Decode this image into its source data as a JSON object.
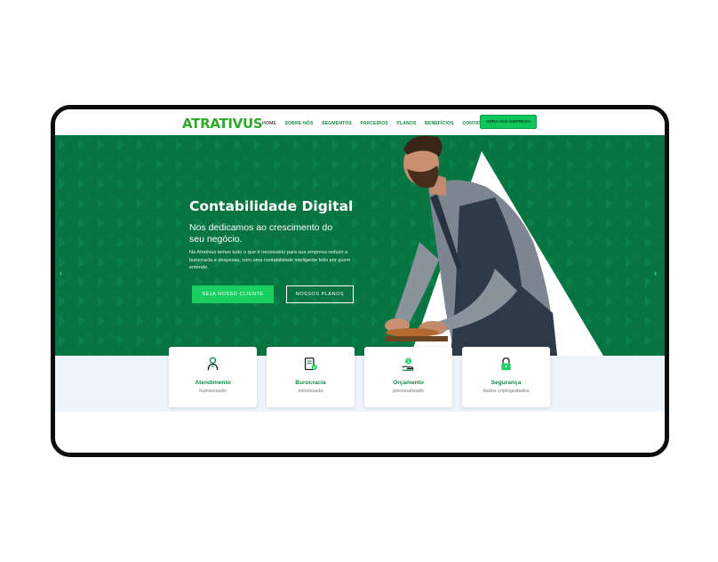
{
  "brand": {
    "name": "ATRATIVUS",
    "color": "#2fa82c"
  },
  "nav": {
    "items": [
      "HOME",
      "SOBRE NÓS",
      "SEGMENTOS",
      "PARCEIROS",
      "PLANOS",
      "BENEFÍCIOS",
      "CONTATO"
    ],
    "cta": "ABRA SUA EMPRESA"
  },
  "hero": {
    "title": "Contabilidade Digital",
    "subtitle": "Nos dedicamos ao crescimento do seu negócio.",
    "text": "Na Atrativus temos tudo o que é necessário para sua empresa reduzir a burocracia e despesas, com uma contabilidade inteligente feito por quem entende.",
    "primary_button": "SEJA NOSSO CLIENTE",
    "secondary_button": "NOSSOS PLANOS",
    "prev_arrow": "‹",
    "next_arrow": "›"
  },
  "features": [
    {
      "title": "Atendimento",
      "subtitle": "humanizado",
      "icon": "person-icon"
    },
    {
      "title": "Burocracia",
      "subtitle": "minimizada",
      "icon": "document-check-icon"
    },
    {
      "title": "Orçamento",
      "subtitle": "personalizado",
      "icon": "money-hand-icon"
    },
    {
      "title": "Segurança",
      "subtitle": "dados criptografados",
      "icon": "padlock-icon"
    }
  ],
  "colors": {
    "hero_green": "#087442",
    "accent_green": "#18cf5f",
    "strip_bg": "#eef4fb"
  }
}
